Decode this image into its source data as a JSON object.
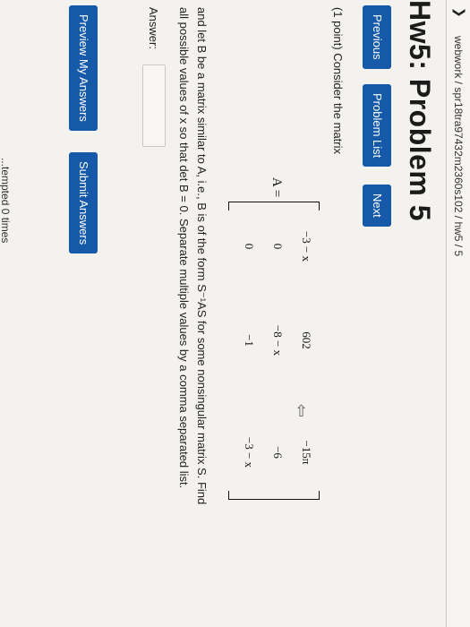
{
  "header": {
    "breadcrumb": "webwork / spr18tra97432m2360s102 / hw5 / 5",
    "title": "Hw5: Problem 5"
  },
  "nav": {
    "previous": "Previous",
    "problem_list": "Problem List",
    "next": "Next"
  },
  "problem": {
    "intro": "(1 point) Consider the matrix",
    "matrix_lhs": "A =",
    "matrix": [
      [
        "−3 − x",
        "602",
        "−15π"
      ],
      [
        "0",
        "−8 − x",
        "−6"
      ],
      [
        "0",
        "−1",
        "−3 − x"
      ]
    ],
    "description_line1": "and let B be a matrix similar to A, i.e., B is of the form S⁻¹AS for some nonsingular matrix S. Find",
    "description_line2": "all possible values of x so that det B = 0. Separate multiple values by a comma separated list."
  },
  "answer": {
    "label": "Answer:",
    "value": ""
  },
  "actions": {
    "preview": "Preview My Answers",
    "submit": "Submit Answers"
  },
  "footer": {
    "text": "...tempted 0 times"
  }
}
